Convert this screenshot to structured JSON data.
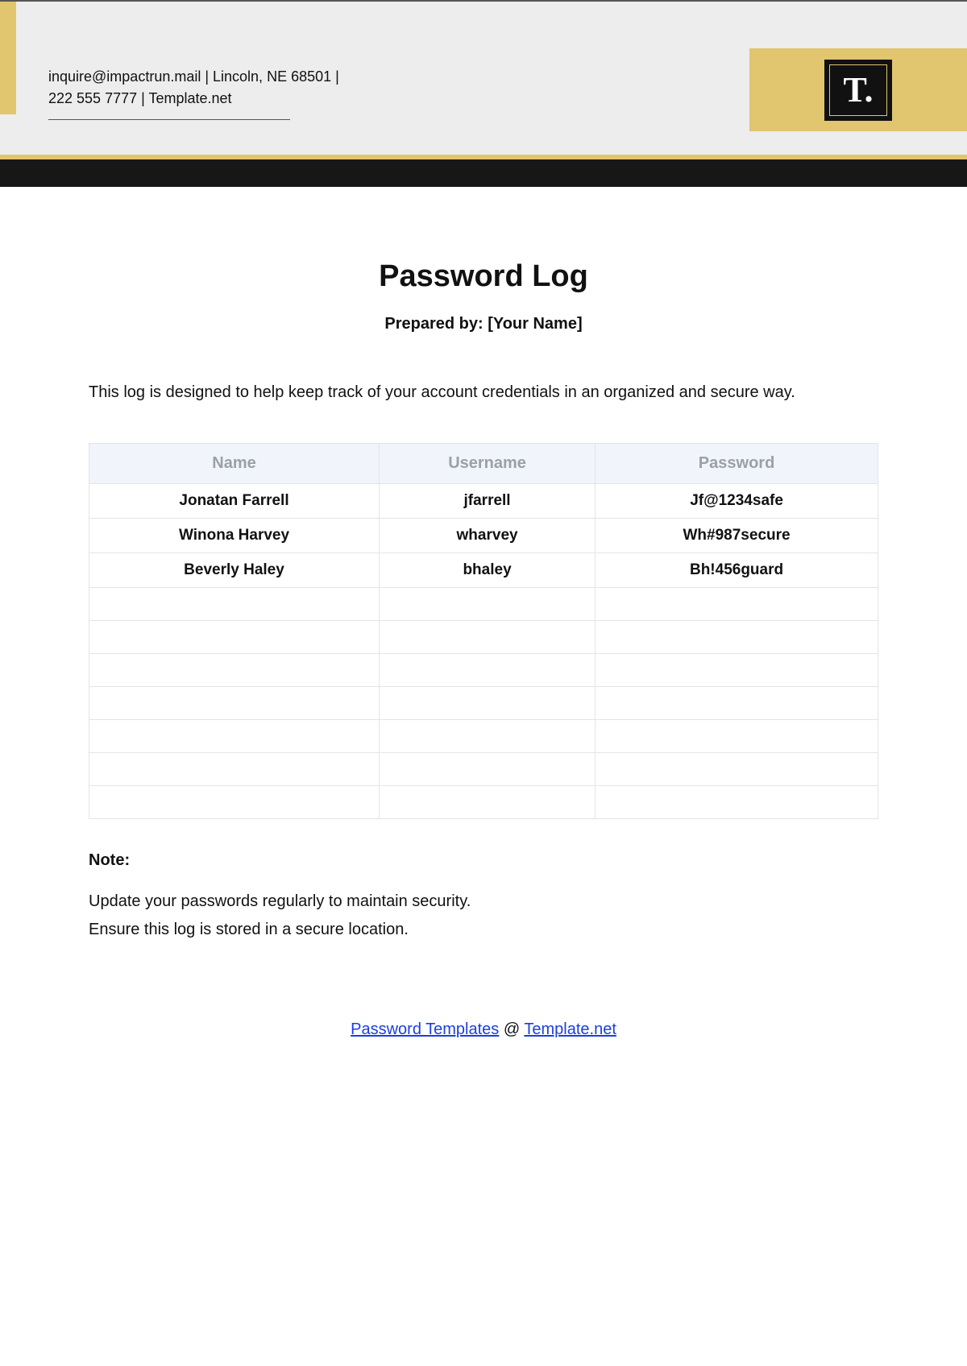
{
  "header": {
    "contact_line1": "inquire@impactrun.mail | Lincoln, NE 68501 |",
    "contact_line2": "222 555 7777 | Template.net",
    "logo_text": "T."
  },
  "document": {
    "title": "Password Log",
    "prepared_by": "Prepared by: [Your Name]",
    "intro": "This log is designed to help keep track of your account credentials in an organized and secure way."
  },
  "table": {
    "headers": [
      "Name",
      "Username",
      "Password"
    ],
    "rows": [
      {
        "name": "Jonatan Farrell",
        "username": "jfarrell",
        "password": "Jf@1234safe"
      },
      {
        "name": "Winona Harvey",
        "username": "wharvey",
        "password": "Wh#987secure"
      },
      {
        "name": "Beverly Haley",
        "username": "bhaley",
        "password": "Bh!456guard"
      },
      {
        "name": "",
        "username": "",
        "password": ""
      },
      {
        "name": "",
        "username": "",
        "password": ""
      },
      {
        "name": "",
        "username": "",
        "password": ""
      },
      {
        "name": "",
        "username": "",
        "password": ""
      },
      {
        "name": "",
        "username": "",
        "password": ""
      },
      {
        "name": "",
        "username": "",
        "password": ""
      },
      {
        "name": "",
        "username": "",
        "password": ""
      }
    ]
  },
  "note": {
    "label": "Note:",
    "line1": "Update your passwords regularly to maintain security.",
    "line2": "Ensure this log is stored in a secure location."
  },
  "footer": {
    "link1": "Password Templates",
    "at": " @ ",
    "link2": "Template.net"
  }
}
